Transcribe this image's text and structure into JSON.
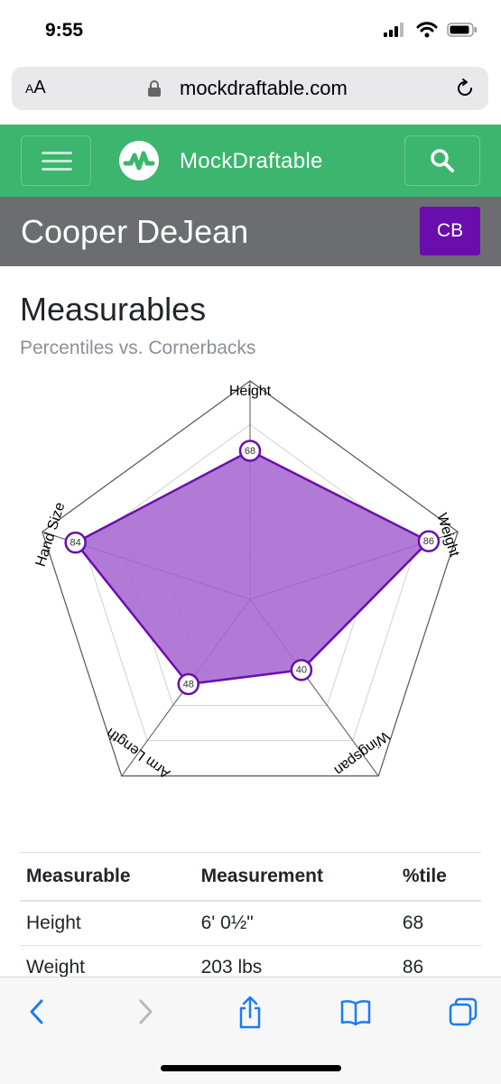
{
  "status": {
    "time": "9:55"
  },
  "browser": {
    "aa_small": "A",
    "aa_large": "A",
    "domain": "mockdraftable.com"
  },
  "nav": {
    "brand": "MockDraftable"
  },
  "player": {
    "name": "Cooper DeJean",
    "position": "CB"
  },
  "section": {
    "title": "Measurables",
    "subtitle": "Percentiles vs. Cornerbacks"
  },
  "colors": {
    "nav_green": "#3cb56f",
    "accent_purple": "#6a0dad",
    "fill_purple": "#a76bd1",
    "header_gray": "#6c6d70"
  },
  "chart_data": {
    "type": "radar",
    "axes": [
      "Height",
      "Weight",
      "Wingspan",
      "Arm Length",
      "Hand Size"
    ],
    "values": [
      68,
      86,
      40,
      48,
      84
    ],
    "range": [
      0,
      100
    ],
    "rings": 4
  },
  "table": {
    "headers": [
      "Measurable",
      "Measurement",
      "%tile"
    ],
    "rows": [
      [
        "Height",
        "6' 0½\"",
        "68"
      ],
      [
        "Weight",
        "203 lbs",
        "86"
      ]
    ]
  },
  "toolbar": {
    "icons": [
      "back-icon",
      "forward-icon",
      "share-icon",
      "bookmarks-icon",
      "tabs-icon"
    ]
  }
}
